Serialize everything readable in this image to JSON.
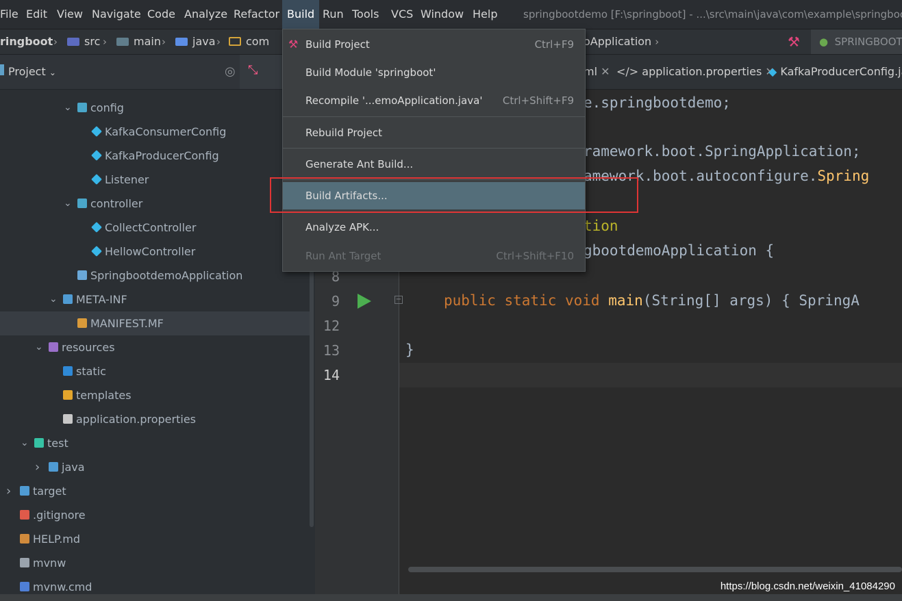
{
  "menubar": {
    "items": [
      "File",
      "Edit",
      "View",
      "Navigate",
      "Code",
      "Analyze",
      "Refactor",
      "Build",
      "Run",
      "Tools",
      "VCS",
      "Window",
      "Help"
    ],
    "active": "Build",
    "window_title": "springbootdemo [F:\\springboot] - ...\\src\\main\\java\\com\\example\\springboo"
  },
  "breadcrumb": {
    "items": [
      "ringboot",
      "src",
      "main",
      "java",
      "com"
    ],
    "tail": "oApplication",
    "run_config": "SPRINGBOOT"
  },
  "project_panel": {
    "title": "Project",
    "tree": [
      {
        "label": "config",
        "icon": "package-icon",
        "indent": 1,
        "arrow": "open"
      },
      {
        "label": "KafkaConsumerConfig",
        "icon": "class-icon",
        "indent": 2
      },
      {
        "label": "KafkaProducerConfig",
        "icon": "class-icon",
        "indent": 2
      },
      {
        "label": "Listener",
        "icon": "class-icon",
        "indent": 2
      },
      {
        "label": "controller",
        "icon": "package-icon",
        "indent": 1,
        "arrow": "open"
      },
      {
        "label": "CollectController",
        "icon": "class-icon",
        "indent": 2
      },
      {
        "label": "HellowController",
        "icon": "class-icon",
        "indent": 2
      },
      {
        "label": "SpringbootdemoApplication",
        "icon": "spring-class-icon",
        "indent": 1
      },
      {
        "label": "META-INF",
        "icon": "folder-icon",
        "indent": 0,
        "arrow": "open"
      },
      {
        "label": "MANIFEST.MF",
        "icon": "manifest-file-icon",
        "indent": 1,
        "selected": true
      },
      {
        "label": "resources",
        "icon": "resources-folder-icon",
        "indent": -1,
        "arrow": "open"
      },
      {
        "label": "static",
        "icon": "web-folder-icon",
        "indent": 0
      },
      {
        "label": "templates",
        "icon": "templates-folder-icon",
        "indent": 0
      },
      {
        "label": "application.properties",
        "icon": "properties-file-icon",
        "indent": 0
      },
      {
        "label": "test",
        "icon": "test-folder-icon",
        "indent": -2,
        "arrow": "open"
      },
      {
        "label": "java",
        "icon": "folder-icon",
        "indent": -1,
        "arrow": "closed"
      },
      {
        "label": "target",
        "icon": "folder-icon",
        "indent": -3,
        "arrow": "closed"
      },
      {
        "label": ".gitignore",
        "icon": "git-icon",
        "indent": -3
      },
      {
        "label": "HELP.md",
        "icon": "markdown-icon",
        "indent": -3
      },
      {
        "label": "mvnw",
        "icon": "file-icon",
        "indent": -3
      },
      {
        "label": "mvnw.cmd",
        "icon": "cmd-file-icon",
        "indent": -3
      }
    ]
  },
  "editor": {
    "tabs": [
      "ml",
      "application.properties",
      "KafkaProducerConfig.jav"
    ],
    "line_numbers": [
      "8",
      "9",
      "12",
      "13",
      "14"
    ],
    "current_line": "14",
    "code": {
      "l1": "e.springbootdemo;",
      "l2": "ramework.boot.SpringApplication;",
      "l3a": "amework.boot.autoconfigure.",
      "l3b": "Spring",
      "l4": "tion",
      "l5a": "gbootdemoApplication {",
      "l9a": "public static void ",
      "l9b": "main",
      "l9c": "(String[] args) { SpringA",
      "l13": "}"
    }
  },
  "build_menu": {
    "items": [
      {
        "label": "Build Project",
        "shortcut": "Ctrl+F9"
      },
      {
        "label": "Build Module 'springboot'",
        "shortcut": ""
      },
      {
        "label": "Recompile '...emoApplication.java'",
        "shortcut": "Ctrl+Shift+F9"
      },
      {
        "label": "Rebuild Project",
        "shortcut": ""
      },
      {
        "label": "Generate Ant Build...",
        "shortcut": ""
      },
      {
        "label": "Build Artifacts...",
        "shortcut": ""
      },
      {
        "label": "Analyze APK...",
        "shortcut": ""
      },
      {
        "label": "Run Ant Target",
        "shortcut": "Ctrl+Shift+F10"
      }
    ],
    "highlighted": "Build Artifacts..."
  },
  "watermark": "https://blog.csdn.net/weixin_41084290",
  "colors": {
    "accent_highlight": "#546e7a",
    "annotation_box": "#e03535",
    "run_arrow": "#4caf50"
  }
}
